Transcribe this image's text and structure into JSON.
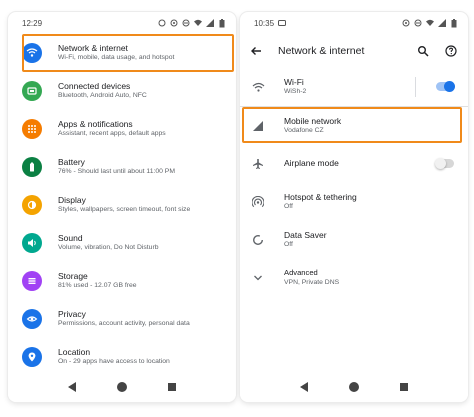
{
  "left": {
    "status_time": "12:29",
    "items": [
      {
        "title": "Network & internet",
        "sub": "Wi-Fi, mobile, data usage, and hotspot",
        "color": "#1a73e8",
        "icon": "wifi-icon"
      },
      {
        "title": "Connected devices",
        "sub": "Bluetooth, Android Auto, NFC",
        "color": "#34a853",
        "icon": "devices-icon"
      },
      {
        "title": "Apps & notifications",
        "sub": "Assistant, recent apps, default apps",
        "color": "#f57c00",
        "icon": "apps-icon"
      },
      {
        "title": "Battery",
        "sub": "76% - Should last until about 11:00 PM",
        "color": "#0b8043",
        "icon": "battery-icon"
      },
      {
        "title": "Display",
        "sub": "Styles, wallpapers, screen timeout, font size",
        "color": "#f4a300",
        "icon": "display-icon"
      },
      {
        "title": "Sound",
        "sub": "Volume, vibration, Do Not Disturb",
        "color": "#00a88f",
        "icon": "sound-icon"
      },
      {
        "title": "Storage",
        "sub": "81% used - 12.07 GB free",
        "color": "#a142f4",
        "icon": "storage-icon"
      },
      {
        "title": "Privacy",
        "sub": "Permissions, account activity, personal data",
        "color": "#1a73e8",
        "icon": "privacy-icon"
      },
      {
        "title": "Location",
        "sub": "On - 29 apps have access to location",
        "color": "#1a73e8",
        "icon": "location-icon"
      }
    ]
  },
  "right": {
    "status_time": "10:35",
    "title": "Network & internet",
    "items": [
      {
        "title": "Wi-Fi",
        "sub": "WiSh-2",
        "icon": "wifi-icon",
        "toggle": "on"
      },
      {
        "title": "Mobile network",
        "sub": "Vodafone CZ",
        "icon": "signal-icon"
      },
      {
        "title": "Airplane mode",
        "sub": "",
        "icon": "airplane-icon",
        "toggle": "off"
      },
      {
        "title": "Hotspot & tethering",
        "sub": "Off",
        "icon": "hotspot-icon"
      },
      {
        "title": "Data Saver",
        "sub": "Off",
        "icon": "data-saver-icon"
      },
      {
        "title": "Advanced",
        "sub": "VPN, Private DNS",
        "icon": "chevron-down-icon"
      }
    ]
  },
  "colors": {
    "highlight": "#f08a1a",
    "accent": "#1a73e8"
  }
}
